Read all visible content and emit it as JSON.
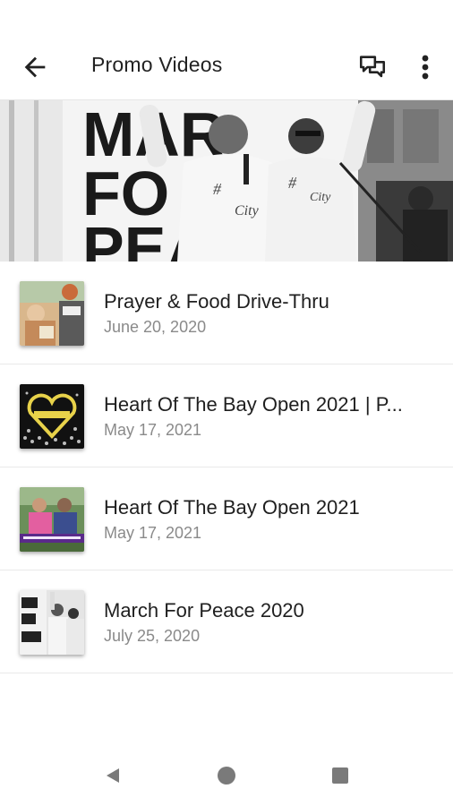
{
  "header": {
    "title": "Promo Videos",
    "back_icon": "arrow-left-icon",
    "chat_icon": "chat-bubbles-icon",
    "more_icon": "more-vertical-icon"
  },
  "hero": {
    "sign_text": "MARCH FOR PEACE"
  },
  "videos": [
    {
      "title": "Prayer & Food Drive-Thru",
      "date": "June 20, 2020"
    },
    {
      "title": "Heart Of The Bay Open 2021 | P...",
      "date": "May 17, 2021"
    },
    {
      "title": "Heart Of The Bay Open 2021",
      "date": "May 17, 2021"
    },
    {
      "title": "March For Peace 2020",
      "date": "July 25, 2020"
    }
  ],
  "system_nav": {
    "back": "triangle-back-icon",
    "home": "circle-home-icon",
    "recents": "square-recents-icon"
  }
}
